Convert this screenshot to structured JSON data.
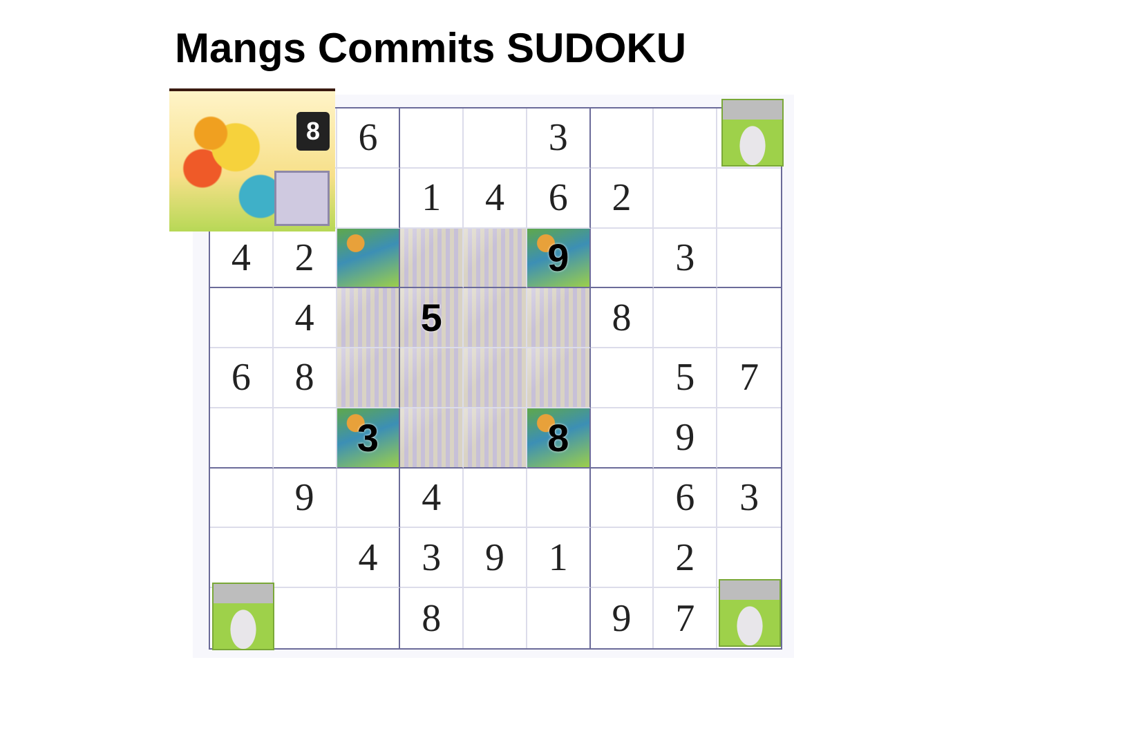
{
  "title": "Mangs Commits SUDOKU",
  "board": {
    "rows": [
      [
        "",
        "",
        "6",
        "",
        "",
        "3",
        "",
        "",
        ""
      ],
      [
        "",
        "",
        "",
        "1",
        "4",
        "6",
        "2",
        "",
        ""
      ],
      [
        "4",
        "2",
        "",
        "",
        "",
        "9",
        "",
        "3",
        ""
      ],
      [
        "",
        "4",
        "",
        "5",
        "",
        "",
        "8",
        "",
        ""
      ],
      [
        "6",
        "8",
        "",
        "",
        "",
        "",
        "",
        "5",
        "7"
      ],
      [
        "",
        "",
        "3",
        "",
        "",
        "8",
        "",
        "9",
        ""
      ],
      [
        "",
        "9",
        "",
        "4",
        "",
        "",
        "",
        "6",
        "3"
      ],
      [
        "",
        "",
        "4",
        "3",
        "9",
        "1",
        "",
        "2",
        ""
      ],
      [
        "",
        "",
        "",
        "8",
        "",
        "",
        "9",
        "7",
        ""
      ]
    ],
    "tile_cells": [
      [
        2,
        2
      ],
      [
        2,
        3
      ],
      [
        2,
        4
      ],
      [
        2,
        5
      ],
      [
        3,
        2
      ],
      [
        3,
        3
      ],
      [
        3,
        4
      ],
      [
        3,
        5
      ],
      [
        4,
        2
      ],
      [
        4,
        3
      ],
      [
        4,
        4
      ],
      [
        4,
        5
      ],
      [
        5,
        2
      ],
      [
        5,
        3
      ],
      [
        5,
        4
      ],
      [
        5,
        5
      ]
    ],
    "grass_cells": [
      [
        2,
        2
      ],
      [
        2,
        5
      ],
      [
        5,
        2
      ],
      [
        5,
        5
      ]
    ],
    "tile_numbers_bold": true
  },
  "sprites": {
    "top_left": {
      "icon": "burning-building-icon",
      "badge": "8"
    },
    "top_right": {
      "icon": "statue-icon"
    },
    "bottom_left": {
      "icon": "statue-icon"
    },
    "bottom_right": {
      "icon": "statue-icon"
    }
  },
  "colors": {
    "grid_major": "#6b6b99",
    "grid_minor": "#dcdcea",
    "text": "#222222"
  }
}
